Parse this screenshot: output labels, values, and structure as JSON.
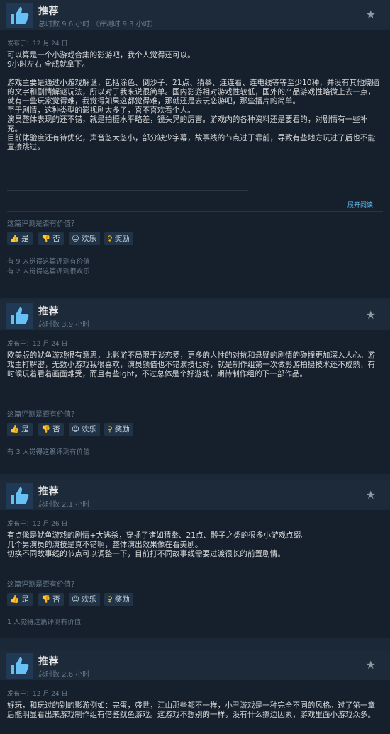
{
  "reviews": [
    {
      "recommendation": "推荐",
      "playtime": "总时数 9.6 小时 （评测时 9.3 小时）",
      "posted": "发布于：12 月 24 日",
      "body": "可以算是一个小游戏合集的影游吧，我个人觉得还可以。\n9小时左右 全成就拿下。\n\n游戏主要是通过小游戏解谜，包括涂色、倒沙子、21点、猜拳、连连看、连电线等等至少10种，并没有其他烧脑的文字和剧情解谜玩法，所以对于我来说很简单。国内影游相对游戏性较低，国外的产品游戏性略微上去一点，就有一些玩家觉得难，我觉得如果这都觉得难，那就还是去玩恋游吧，那些播片的简单。\n至于剧情，这种类型的影视剧太多了，喜不喜欢看个人。\n演员整体表现的还不错，就是拍摄水平略差，镜头晃的厉害。游戏内的各种资料还是要看的，对剧情有一些补充。\n目前体验度还有待优化，声音忽大忽小，部分缺少字幕，故事线的节点过于靠前，导致有些地方玩过了后也不能直接跳过。",
      "expand": "展开阅读",
      "helpful_question": "这篇评测是否有价值？",
      "buttons": {
        "yes": "是",
        "no": "否",
        "funny": "欢乐",
        "award": "奖励"
      },
      "stats": [
        "有 9 人觉得这篇评测有价值",
        "有 2 人觉得这篇评测很欢乐"
      ]
    },
    {
      "recommendation": "推荐",
      "playtime": "总时数 3.9 小时",
      "posted": "发布于：12 月 24 日",
      "body": "欧美版的鱿鱼游戏很有意思，比影游不局限于谈恋爱，更多的人性的对抗和悬疑的剧情的碰撞更加深入人心。游戏主打解密，无数小游戏我很喜欢，演员颜值也不错演技也好，就是制作组第一次做影游拍摄技术还不成熟，有时候玩着看着画面难受，而且有些lgbt，不过总体是个好游戏，期待制作组的下一部作品。",
      "helpful_question": "这篇评测是否有价值？",
      "buttons": {
        "yes": "是",
        "no": "否",
        "funny": "欢乐",
        "award": "奖励"
      },
      "stats": [
        "有 3 人觉得这篇评测有价值"
      ]
    },
    {
      "recommendation": "推荐",
      "playtime": "总时数 2.1 小时",
      "posted": "发布于：12 月 26 日",
      "body": "有点像是鱿鱼游戏的剧情+大逃杀，穿插了诸如猜拳、21点、骰子之类的很多小游戏点缀。\n几个男演员的演技是真不错啊，整体演出效果像在看美剧。\n切换不同故事线的节点可以调整一下，目前打不同故事线需要过渡很长的前置剧情。",
      "helpful_question": "这篇评测是否有价值？",
      "buttons": {
        "yes": "是",
        "no": "否",
        "funny": "欢乐",
        "award": "奖励"
      },
      "stats": [
        "1 人觉得这篇评测有价值"
      ]
    },
    {
      "recommendation": "推荐",
      "playtime": "总时数 2.6 小时",
      "posted": "发布于：12 月 24 日",
      "body": "好玩，和玩过的别的影游例如：完蛋，盛世，江山那些都不一样，小丑游戏是一种完全不同的风格。过了第一章后能明显看出来游戏制作组有借鉴鱿鱼游戏。这游戏不想别的一样，没有什么擦边因素，游戏里面小游戏众多。"
    }
  ]
}
